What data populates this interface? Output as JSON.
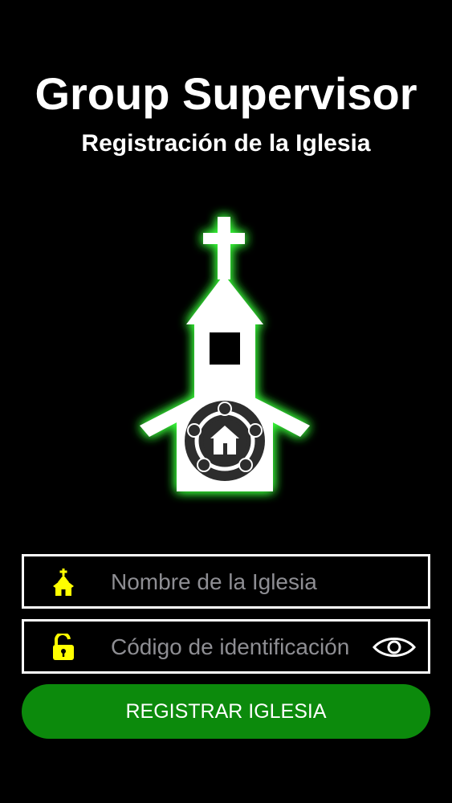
{
  "header": {
    "title": "Group Supervisor",
    "subtitle": "Registración de la Iglesia"
  },
  "logo": {
    "icon": "church-logo-icon",
    "glow_color": "#39ff3a"
  },
  "form": {
    "church_name": {
      "icon": "church-icon",
      "placeholder": "Nombre de la Iglesia",
      "value": ""
    },
    "id_code": {
      "icon": "unlock-icon",
      "placeholder": "Código de identificación",
      "value": "",
      "toggle_icon": "eye-icon"
    },
    "submit_label": "REGISTRAR IGLESIA"
  },
  "colors": {
    "background": "#000000",
    "accent_green": "#0c8a0c",
    "icon_yellow": "#ffff00",
    "field_border": "#ffffff"
  }
}
